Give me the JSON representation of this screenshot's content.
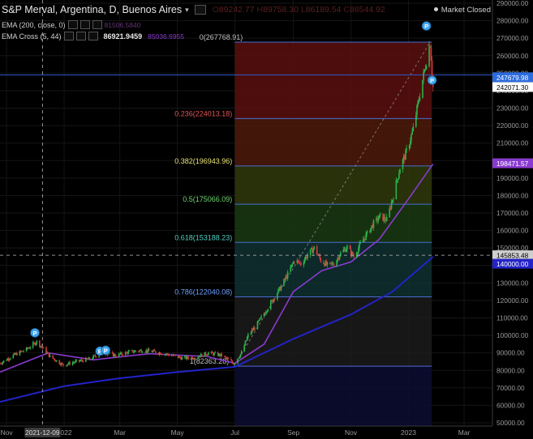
{
  "header": {
    "symbol": "S&P Merval, Argentina, D, Buenos Aires",
    "market_status": "Market Closed",
    "ohlc": [
      {
        "k": "O",
        "v": "89242.77"
      },
      {
        "k": "H",
        "v": "89758.30"
      },
      {
        "k": "L",
        "v": "86189.54"
      },
      {
        "k": "C",
        "v": "86544.92"
      }
    ]
  },
  "indicators": [
    {
      "label": "EMA (200, close, 0)",
      "values": [
        "81506.5840"
      ]
    },
    {
      "label": "EMA Cross (5, 44)",
      "values": [
        "86921.9459",
        "85036.6955"
      ]
    }
  ],
  "colors": {
    "background": "#000000",
    "candle_up": "#2db34a",
    "candle_down": "#d23a3a",
    "ema200": "#2323c8",
    "ema44": "#8a3ad0",
    "fib_line": "#4a6cd4",
    "fib_label": "#8ab4ff"
  },
  "chart_data": {
    "type": "candlestick",
    "ylim": [
      50000,
      290000
    ],
    "y_ticks": [
      50000,
      60000,
      70000,
      80000,
      90000,
      100000,
      110000,
      120000,
      130000,
      140000,
      150000,
      160000,
      170000,
      180000,
      190000,
      200000,
      210000,
      220000,
      230000,
      240000,
      250000,
      260000,
      270000,
      280000,
      290000
    ],
    "y_tick_labels": [
      "50000.00",
      "60000.00",
      "70000.00",
      "80000.00",
      "90000.00",
      "100000.00",
      "110000.00",
      "120000.00",
      "130000.00",
      "140000.00",
      "150000.00",
      "160000.00",
      "170000.00",
      "180000.00",
      "190000.00",
      "200000.00",
      "210000.00",
      "220000.00",
      "230000.00",
      "240000.00",
      "250000.00",
      "260000.00",
      "270000.00",
      "280000.00",
      "290000.00"
    ],
    "x_range": [
      "2021-10-25",
      "2023-03-31"
    ],
    "x_ticks": [
      {
        "date": "2021-11-01",
        "label": "Nov"
      },
      {
        "date": "2022-01-01",
        "label": "2022"
      },
      {
        "date": "2022-03-01",
        "label": "Mar"
      },
      {
        "date": "2022-05-01",
        "label": "May"
      },
      {
        "date": "2022-07-01",
        "label": "Jul"
      },
      {
        "date": "2022-09-01",
        "label": "Sep"
      },
      {
        "date": "2022-11-01",
        "label": "Nov"
      },
      {
        "date": "2023-01-01",
        "label": "2023"
      },
      {
        "date": "2023-03-01",
        "label": "Mar"
      }
    ],
    "crosshair": {
      "date": "2021-12-09",
      "date_label": "2021-12-09",
      "value": 145853.48,
      "value_label": "145853.48"
    },
    "price_tags": [
      {
        "label": "247679.98",
        "value": 247679.98,
        "color": "#2d6cdf"
      },
      {
        "label": "242071.30",
        "value": 242071.3,
        "color": "#ffffff"
      },
      {
        "label": "198471.57",
        "value": 198471.57,
        "color": "#8a3ad0"
      },
      {
        "label": "145853.48",
        "value": 145853.48,
        "color": "#cfcfcf"
      },
      {
        "label": "140000.00",
        "value": 141000,
        "color": "#2323c8"
      }
    ],
    "hline": 249000,
    "fibonacci": {
      "start_date": "2022-07-01",
      "end_date": "2023-01-24",
      "levels": [
        {
          "ratio": "0",
          "price": 267768.91,
          "label": "0(267768.91)",
          "fill": "#5a0f0f"
        },
        {
          "ratio": "0.236",
          "price": 224013.18,
          "label": "0.236(224013.18)",
          "fill": "#4d1a0a"
        },
        {
          "ratio": "0.382",
          "price": 196943.96,
          "label": "0.382(196943.96)",
          "fill": "#2f3a0c"
        },
        {
          "ratio": "0.5",
          "price": 175066.09,
          "label": "0.5(175066.09)",
          "fill": "#1a3a12"
        },
        {
          "ratio": "0.618",
          "price": 153188.23,
          "label": "0.618(153188.23)",
          "fill": "#0f3030"
        },
        {
          "ratio": "0.786",
          "price": 122040.08,
          "label": "0.786(122040.08)",
          "fill": "#1b1b1b"
        },
        {
          "ratio": "1",
          "price": 82363.28,
          "label": "1(82363.28)",
          "fill": "#0c0c33"
        }
      ]
    },
    "pivot_markers": [
      {
        "date": "2021-12-01",
        "value": 101500,
        "label": "P"
      },
      {
        "date": "2022-02-08",
        "value": 91000,
        "label": "P"
      },
      {
        "date": "2022-02-14",
        "value": 91500,
        "label": "P"
      },
      {
        "date": "2023-01-20",
        "value": 277000,
        "label": "P"
      },
      {
        "date": "2023-01-26",
        "value": 246000,
        "label": "P"
      }
    ],
    "price_path": [
      [
        "2021-10-25",
        84000
      ],
      [
        "2021-11-08",
        88500
      ],
      [
        "2021-11-22",
        92000
      ],
      [
        "2021-12-03",
        96500
      ],
      [
        "2021-12-17",
        88000
      ],
      [
        "2021-12-31",
        83000
      ],
      [
        "2022-01-14",
        85000
      ],
      [
        "2022-01-28",
        86500
      ],
      [
        "2022-02-11",
        90500
      ],
      [
        "2022-02-25",
        88500
      ],
      [
        "2022-03-11",
        90500
      ],
      [
        "2022-03-25",
        91500
      ],
      [
        "2022-04-08",
        90500
      ],
      [
        "2022-04-22",
        89000
      ],
      [
        "2022-05-06",
        87000
      ],
      [
        "2022-05-20",
        87500
      ],
      [
        "2022-06-03",
        90000
      ],
      [
        "2022-06-17",
        88500
      ],
      [
        "2022-06-30",
        84000
      ],
      [
        "2022-07-08",
        90000
      ],
      [
        "2022-07-15",
        100000
      ],
      [
        "2022-07-22",
        104500
      ],
      [
        "2022-07-29",
        110000
      ],
      [
        "2022-08-05",
        116000
      ],
      [
        "2022-08-12",
        122000
      ],
      [
        "2022-08-19",
        128000
      ],
      [
        "2022-08-26",
        135000
      ],
      [
        "2022-09-02",
        143000
      ],
      [
        "2022-09-09",
        141000
      ],
      [
        "2022-09-16",
        146000
      ],
      [
        "2022-09-23",
        150000
      ],
      [
        "2022-09-30",
        143000
      ],
      [
        "2022-10-07",
        140000
      ],
      [
        "2022-10-14",
        141000
      ],
      [
        "2022-10-21",
        147000
      ],
      [
        "2022-10-28",
        150500
      ],
      [
        "2022-11-04",
        145000
      ],
      [
        "2022-11-11",
        152000
      ],
      [
        "2022-11-18",
        158000
      ],
      [
        "2022-11-25",
        164000
      ],
      [
        "2022-12-02",
        168000
      ],
      [
        "2022-12-09",
        166000
      ],
      [
        "2022-12-16",
        180000
      ],
      [
        "2022-12-23",
        196000
      ],
      [
        "2022-12-30",
        205000
      ],
      [
        "2023-01-06",
        218000
      ],
      [
        "2023-01-13",
        238000
      ],
      [
        "2023-01-20",
        257000
      ],
      [
        "2023-01-24",
        267800
      ],
      [
        "2023-01-27",
        242000
      ]
    ],
    "ema44_path": [
      [
        "2021-10-25",
        79000
      ],
      [
        "2021-12-15",
        90000
      ],
      [
        "2022-02-01",
        86000
      ],
      [
        "2022-04-01",
        89500
      ],
      [
        "2022-06-01",
        88000
      ],
      [
        "2022-07-01",
        84000
      ],
      [
        "2022-08-01",
        95000
      ],
      [
        "2022-09-01",
        125000
      ],
      [
        "2022-10-01",
        137000
      ],
      [
        "2022-11-01",
        142000
      ],
      [
        "2022-12-01",
        155000
      ],
      [
        "2023-01-01",
        178000
      ],
      [
        "2023-01-27",
        198000
      ]
    ],
    "ema200_path": [
      [
        "2021-10-25",
        62000
      ],
      [
        "2022-01-01",
        71000
      ],
      [
        "2022-03-01",
        75500
      ],
      [
        "2022-05-01",
        79000
      ],
      [
        "2022-07-01",
        82000
      ],
      [
        "2022-09-01",
        98000
      ],
      [
        "2022-11-01",
        112000
      ],
      [
        "2022-12-15",
        125000
      ],
      [
        "2023-01-27",
        145000
      ]
    ]
  }
}
